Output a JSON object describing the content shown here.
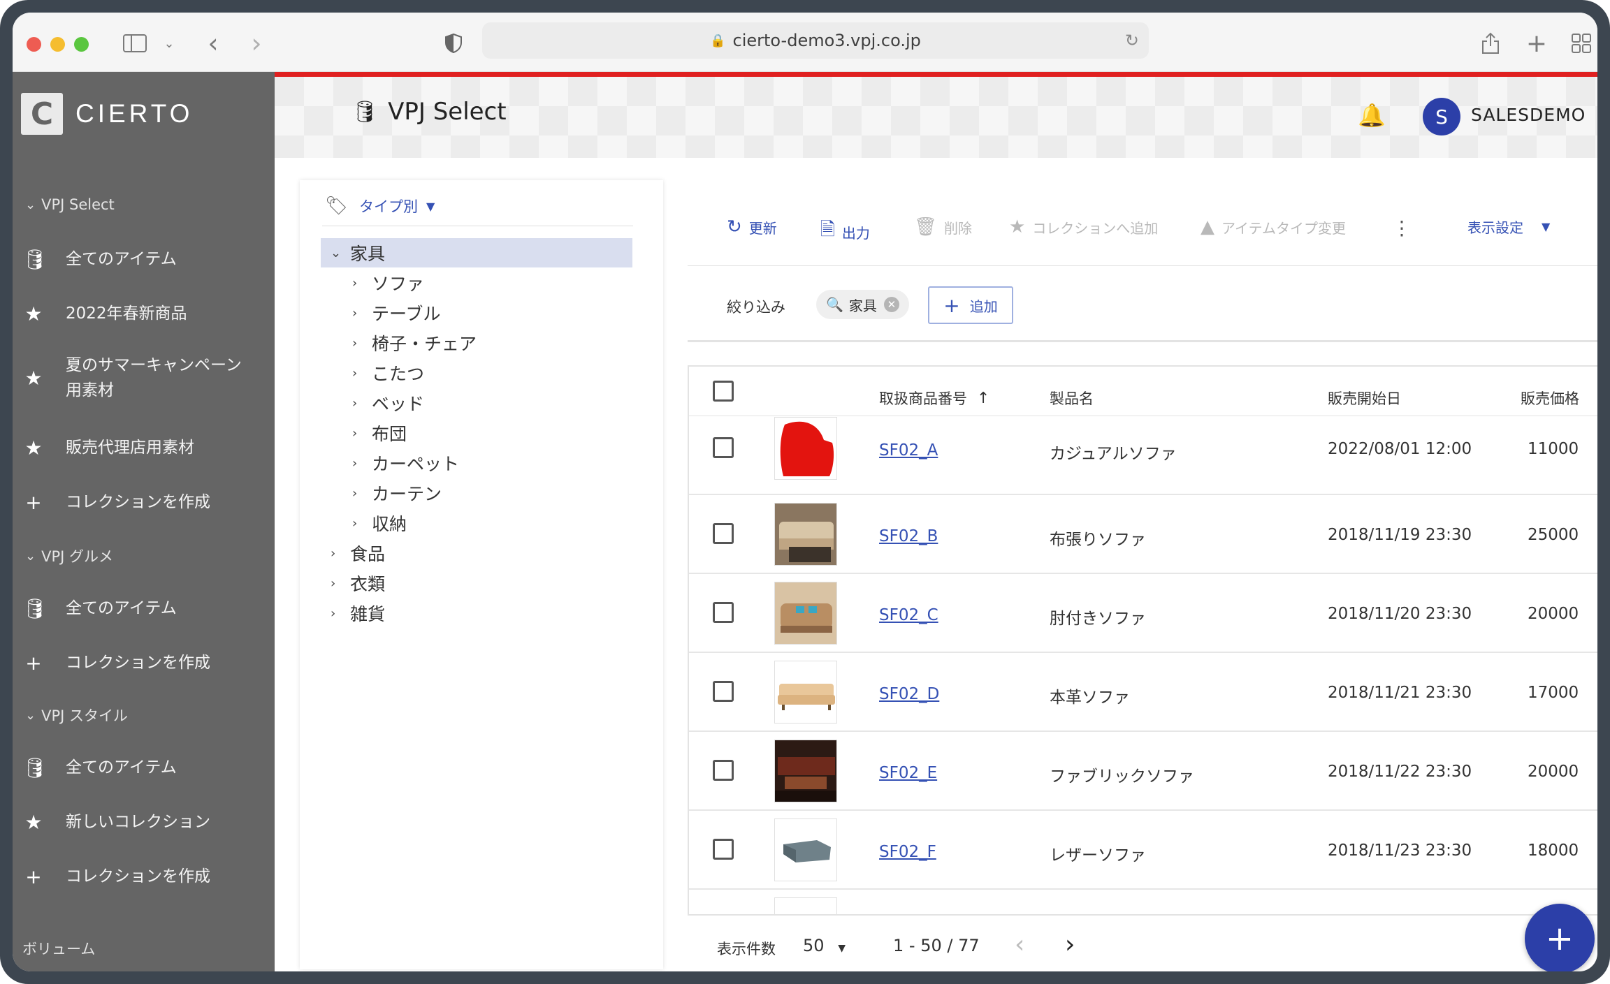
{
  "browser": {
    "url": "cierto-demo3.vpj.co.jp",
    "traffic": [
      "#ee5c52",
      "#f5bd2f",
      "#5ac63f"
    ]
  },
  "sidebar": {
    "brand": "CIERTO",
    "groups": [
      {
        "title": "VPJ Select",
        "items": [
          {
            "icon": "database-icon",
            "label": "全てのアイテム"
          },
          {
            "icon": "star-icon",
            "label": "2022年春新商品"
          },
          {
            "icon": "star-icon",
            "label": "夏のサマーキャンペーン用素材"
          },
          {
            "icon": "star-icon",
            "label": "販売代理店用素材"
          },
          {
            "icon": "plus-icon",
            "label": "コレクションを作成"
          }
        ]
      },
      {
        "title": "VPJ グルメ",
        "items": [
          {
            "icon": "database-icon",
            "label": "全てのアイテム"
          },
          {
            "icon": "plus-icon",
            "label": "コレクションを作成"
          }
        ]
      },
      {
        "title": "VPJ スタイル",
        "items": [
          {
            "icon": "database-icon",
            "label": "全てのアイテム"
          },
          {
            "icon": "star-icon",
            "label": "新しいコレクション"
          },
          {
            "icon": "plus-icon",
            "label": "コレクションを作成"
          }
        ]
      }
    ],
    "volume": "ボリューム"
  },
  "header": {
    "title": "VPJ Select",
    "avatar_initial": "S",
    "username": "SALESDEMO",
    "accent": "#e02020"
  },
  "tree": {
    "heading": "タイプ別",
    "root": "家具",
    "children": [
      "ソファ",
      "テーブル",
      "椅子・チェア",
      "こたつ",
      "ベッド",
      "布団",
      "カーペット",
      "カーテン",
      "収納"
    ],
    "siblings": [
      "食品",
      "衣類",
      "雑貨"
    ]
  },
  "toolbar": {
    "refresh": "更新",
    "export": "出力",
    "delete": "削除",
    "add_collection": "コレクションへ追加",
    "change_type": "アイテムタイプ変更",
    "display_settings": "表示設定"
  },
  "filter": {
    "label": "絞り込み",
    "chip": "家具",
    "add": "追加"
  },
  "table": {
    "columns": [
      "取扱商品番号",
      "製品名",
      "販売開始日",
      "販売価格"
    ],
    "rows": [
      {
        "id": "SF02_A",
        "name": "カジュアルソファ",
        "date": "2022/08/01 12:00",
        "price": "11000",
        "thumb": "#e3140f"
      },
      {
        "id": "SF02_B",
        "name": "布張りソファ",
        "date": "2018/11/19 23:30",
        "price": "25000",
        "thumb": "#c9b497"
      },
      {
        "id": "SF02_C",
        "name": "肘付きソファ",
        "date": "2018/11/20 23:30",
        "price": "20000",
        "thumb": "#c49b72"
      },
      {
        "id": "SF02_D",
        "name": "本革ソファ",
        "date": "2018/11/21 23:30",
        "price": "17000",
        "thumb": "#e9c79a"
      },
      {
        "id": "SF02_E",
        "name": "ファブリックソファ",
        "date": "2018/11/22 23:30",
        "price": "20000",
        "thumb": "#6e2a1c"
      },
      {
        "id": "SF02_F",
        "name": "レザーソファ",
        "date": "2018/11/23 23:30",
        "price": "18000",
        "thumb": "#6f8189"
      }
    ]
  },
  "footer": {
    "per_page_label": "表示件数",
    "per_page": "50",
    "range": "1 - 50 / 77"
  },
  "fab": "+"
}
